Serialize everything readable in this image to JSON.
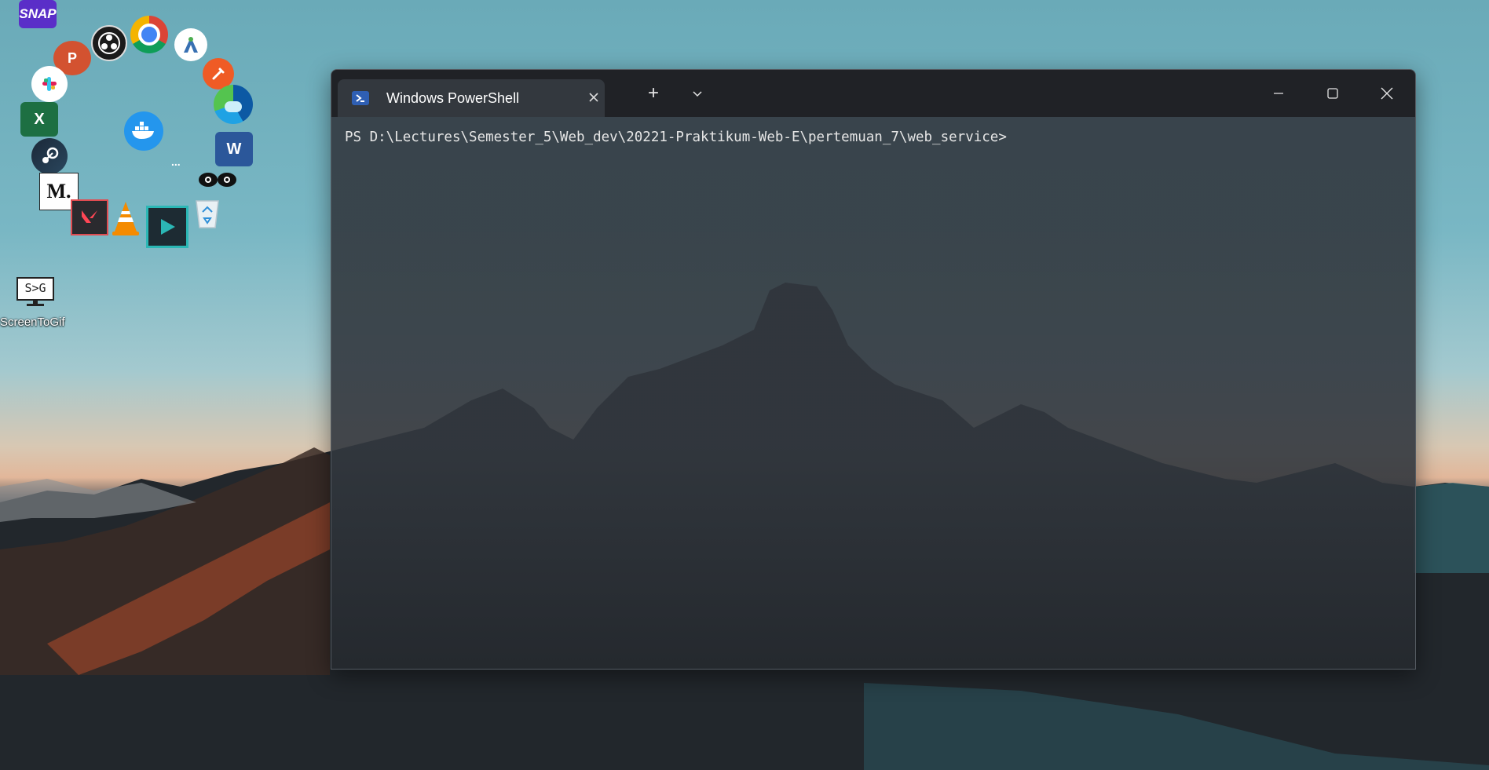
{
  "desktop": {
    "icons": [
      {
        "name": "snap-icon",
        "label": "SNAP"
      },
      {
        "name": "powerpoint-icon",
        "label": "P"
      },
      {
        "name": "obs-icon"
      },
      {
        "name": "chrome-icon"
      },
      {
        "name": "android-studio-icon"
      },
      {
        "name": "slack-icon"
      },
      {
        "name": "postman-icon"
      },
      {
        "name": "excel-icon",
        "label": "X"
      },
      {
        "name": "docker-icon"
      },
      {
        "name": "edge-icon"
      },
      {
        "name": "steam-icon"
      },
      {
        "name": "word-icon",
        "label": "W"
      },
      {
        "name": "medium-icon",
        "label": "M."
      },
      {
        "name": "eyes-icon"
      },
      {
        "name": "valorant-icon"
      },
      {
        "name": "vlc-icon"
      },
      {
        "name": "powerdirector-icon"
      },
      {
        "name": "recycle-bin-icon"
      },
      {
        "name": "screentogif-icon",
        "label": "S>G"
      }
    ],
    "screentogif_label": "ScreenToGif",
    "dots_label": "..."
  },
  "terminal": {
    "tab_title": "Windows PowerShell",
    "new_tab_symbol": "+",
    "prompt": "PS D:\\Lectures\\Semester_5\\Web_dev\\20221-Praktikum-Web-E\\pertemuan_7\\web_service>"
  },
  "colors": {
    "titlebar": "#202226",
    "tab_active": "#33383e",
    "terminal_text": "#e6e6e6",
    "powershell_blue": "#2f5fb3"
  }
}
